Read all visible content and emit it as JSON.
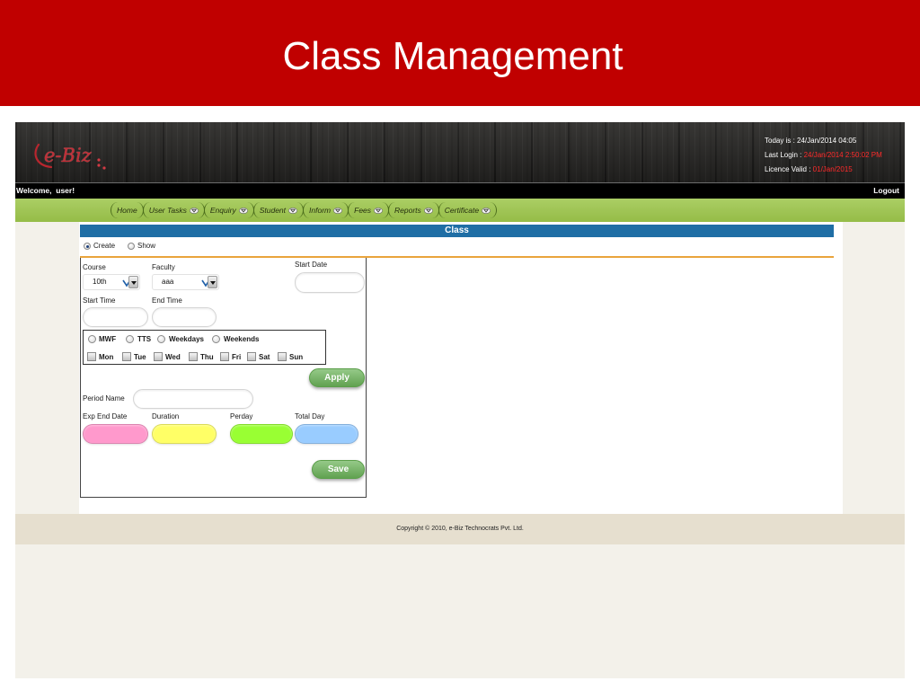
{
  "slide": {
    "title": "Class Management"
  },
  "header": {
    "logo_text": "e-Biz",
    "today": {
      "label": "Today is : ",
      "value": "24/Jan/2014 04:05"
    },
    "last_login": {
      "label": "Last Login : ",
      "value": "24/Jan/2014 2:50:02 PM"
    },
    "licence": {
      "label": "Licence Valid : ",
      "value": "01/Jan/2015"
    }
  },
  "userbar": {
    "welcome": "Welcome,  user!",
    "logout": "Logout"
  },
  "nav": {
    "items": [
      {
        "label": "Home",
        "dropdown": false
      },
      {
        "label": "User Tasks",
        "dropdown": true
      },
      {
        "label": "Enquiry",
        "dropdown": true
      },
      {
        "label": "Student",
        "dropdown": true
      },
      {
        "label": "Inform",
        "dropdown": true
      },
      {
        "label": "Fees",
        "dropdown": true
      },
      {
        "label": "Reports",
        "dropdown": true
      },
      {
        "label": "Certificate",
        "dropdown": true
      }
    ]
  },
  "panel": {
    "title": "Class"
  },
  "mode": {
    "options": [
      {
        "label": "Create",
        "selected": true
      },
      {
        "label": "Show",
        "selected": false
      }
    ]
  },
  "form": {
    "course": {
      "label": "Course",
      "value": "10th"
    },
    "faculty": {
      "label": "Faculty",
      "value": "aaa"
    },
    "start_date": {
      "label": "Start Date",
      "value": ""
    },
    "start_time": {
      "label": "Start Time",
      "value": ""
    },
    "end_time": {
      "label": "End Time",
      "value": ""
    },
    "schedule_options": [
      {
        "label": "MWF",
        "selected": false
      },
      {
        "label": "TTS",
        "selected": false
      },
      {
        "label": "Weekdays",
        "selected": false
      },
      {
        "label": "Weekends",
        "selected": false
      }
    ],
    "days": [
      {
        "label": "Mon",
        "checked": false
      },
      {
        "label": "Tue",
        "checked": false
      },
      {
        "label": "Wed",
        "checked": false
      },
      {
        "label": "Thu",
        "checked": false
      },
      {
        "label": "Fri",
        "checked": false
      },
      {
        "label": "Sat",
        "checked": false
      },
      {
        "label": "Sun",
        "checked": false
      }
    ],
    "apply_label": "Apply",
    "period_name": {
      "label": "Period Name",
      "value": ""
    },
    "exp_end_date": {
      "label": "Exp End Date",
      "value": "",
      "color": "#ff99cc"
    },
    "duration": {
      "label": "Duration",
      "value": "",
      "color": "#ffff66"
    },
    "perday": {
      "label": "Perday",
      "value": "",
      "color": "#99ff33"
    },
    "total_day": {
      "label": "Total Day",
      "value": "",
      "color": "#99ccff"
    },
    "save_label": "Save"
  },
  "footer": {
    "copyright": "Copyright © 2010, e-Biz Technocrats Pvt. Ltd."
  },
  "colors": {
    "banner": "#c00000",
    "nav": "#9dc64b",
    "panel_header": "#1f6ea5",
    "rule": "#e9a43c",
    "button": "#6cb45a",
    "highlight_text": "#ff2a2a",
    "footer": "#e6dfcf"
  }
}
